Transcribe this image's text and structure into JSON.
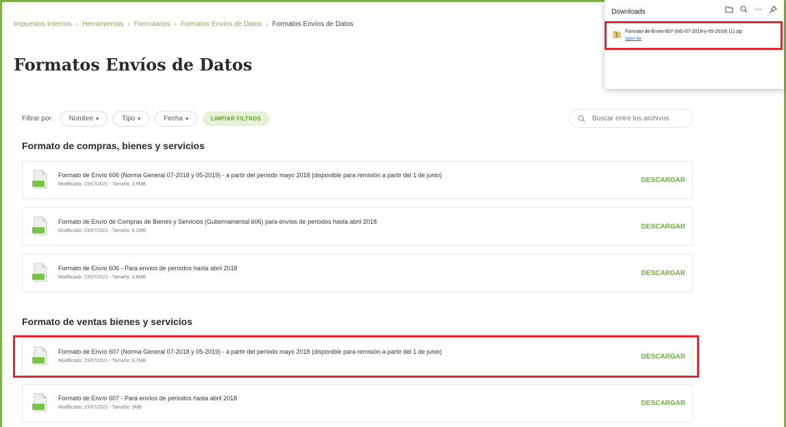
{
  "breadcrumb": {
    "items": [
      "Impuestos Internos",
      "Herramientas",
      "Formularios",
      "Formatos Envíos de Datos"
    ],
    "current": "Formatos Envíos de Datos",
    "separator": "›"
  },
  "page_title": "Formatos Envíos de Datos",
  "filters": {
    "label": "Filtrar por:",
    "nombre": "Nombre",
    "tipo": "Tipo",
    "fecha": "Fecha",
    "clear": "LIMPIAR FILTROS"
  },
  "search": {
    "placeholder": "Buscar entre los archivos"
  },
  "sections": [
    {
      "title": "Formato de compras, bienes y servicios",
      "files": [
        {
          "name": "Formato de Envío 606 (Norma General 07-2018 y 05-2019) - a partir del período mayo 2018 (disponible para remisión a partir del 1 de junio)",
          "meta": "Modificado: 23/07/2021 - Tamaño: 3,9MB",
          "action": "DESCARGAR"
        },
        {
          "name": "Formato de Envío de Compras de Bienes y Servicios (Gubernamental 606) para envíos de periodos hasta abril 2018",
          "meta": "Modificado: 23/07/2021 - Tamaño: 6,2MB",
          "action": "DESCARGAR"
        },
        {
          "name": "Formato de Envío 606 - Para envíos de períodos hasta abril 2018",
          "meta": "Modificado: 23/07/2021 - Tamaño: 3,8MB",
          "action": "DESCARGAR"
        }
      ]
    },
    {
      "title": "Formato de ventas bienes y servicios",
      "files": [
        {
          "name": "Formato de Envío 607 (Norma General 07-2018 y 05-2019) - a partir del período mayo 2018 (disponible para remisión a partir del 1 de junio)",
          "meta": "Modificado: 23/07/2021 - Tamaño: 8,7MB",
          "action": "DESCARGAR"
        },
        {
          "name": "Formato de Envío 607 - Para envíos de periodos hasta abril 2018",
          "meta": "Modificado: 23/07/2021 - Tamaño: 3MB",
          "action": "DESCARGAR"
        }
      ]
    }
  ],
  "zip_label": "ZIP",
  "downloads": {
    "title": "Downloads",
    "icons": [
      "folder-icon",
      "search-icon",
      "more-icon",
      "pin-icon"
    ],
    "item": {
      "filename": "Formato-de-Envio-607-(NG-07-2018-y-05-2019) (1).zip",
      "link": "Open file"
    }
  },
  "colors": {
    "accent_green": "#7cb342",
    "download_green": "#6fae3a",
    "highlight_red": "#e0262e",
    "link_blue": "#1a63d6"
  }
}
